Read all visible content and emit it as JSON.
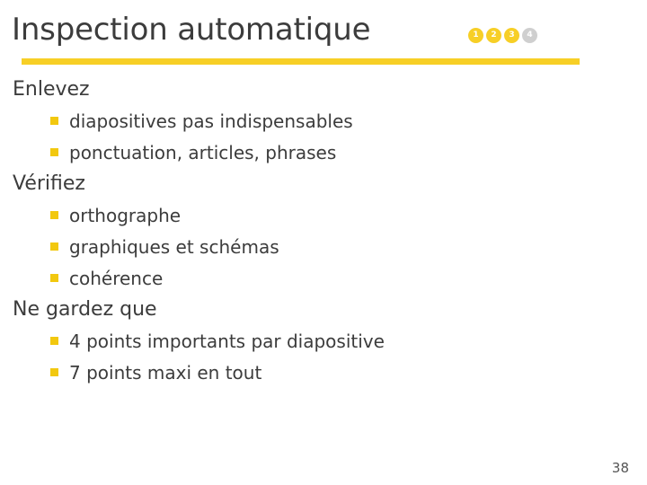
{
  "slide": {
    "title": "Inspection automatique",
    "steps": [
      {
        "label": "1",
        "state": "active"
      },
      {
        "label": "2",
        "state": "active"
      },
      {
        "label": "3",
        "state": "active"
      },
      {
        "label": "4",
        "state": "inactive"
      }
    ],
    "accent_color": "#f7cf26",
    "bullet_color": "#f2c80f",
    "text_color": "#3c3c3c",
    "inactive_color": "#cfcfcf",
    "content": [
      {
        "level": 1,
        "text": "Enlevez"
      },
      {
        "level": 2,
        "text": "diapositives pas indispensables"
      },
      {
        "level": 2,
        "text": "ponctuation, articles, phrases"
      },
      {
        "level": 1,
        "text": "Vérifiez"
      },
      {
        "level": 2,
        "text": "orthographe"
      },
      {
        "level": 2,
        "text": "graphiques et schémas"
      },
      {
        "level": 2,
        "text": "cohérence"
      },
      {
        "level": 1,
        "text": "Ne gardez que"
      },
      {
        "level": 2,
        "text": "4 points importants par diapositive"
      },
      {
        "level": 2,
        "text": "7 points maxi en tout"
      }
    ],
    "page_number": "38"
  }
}
